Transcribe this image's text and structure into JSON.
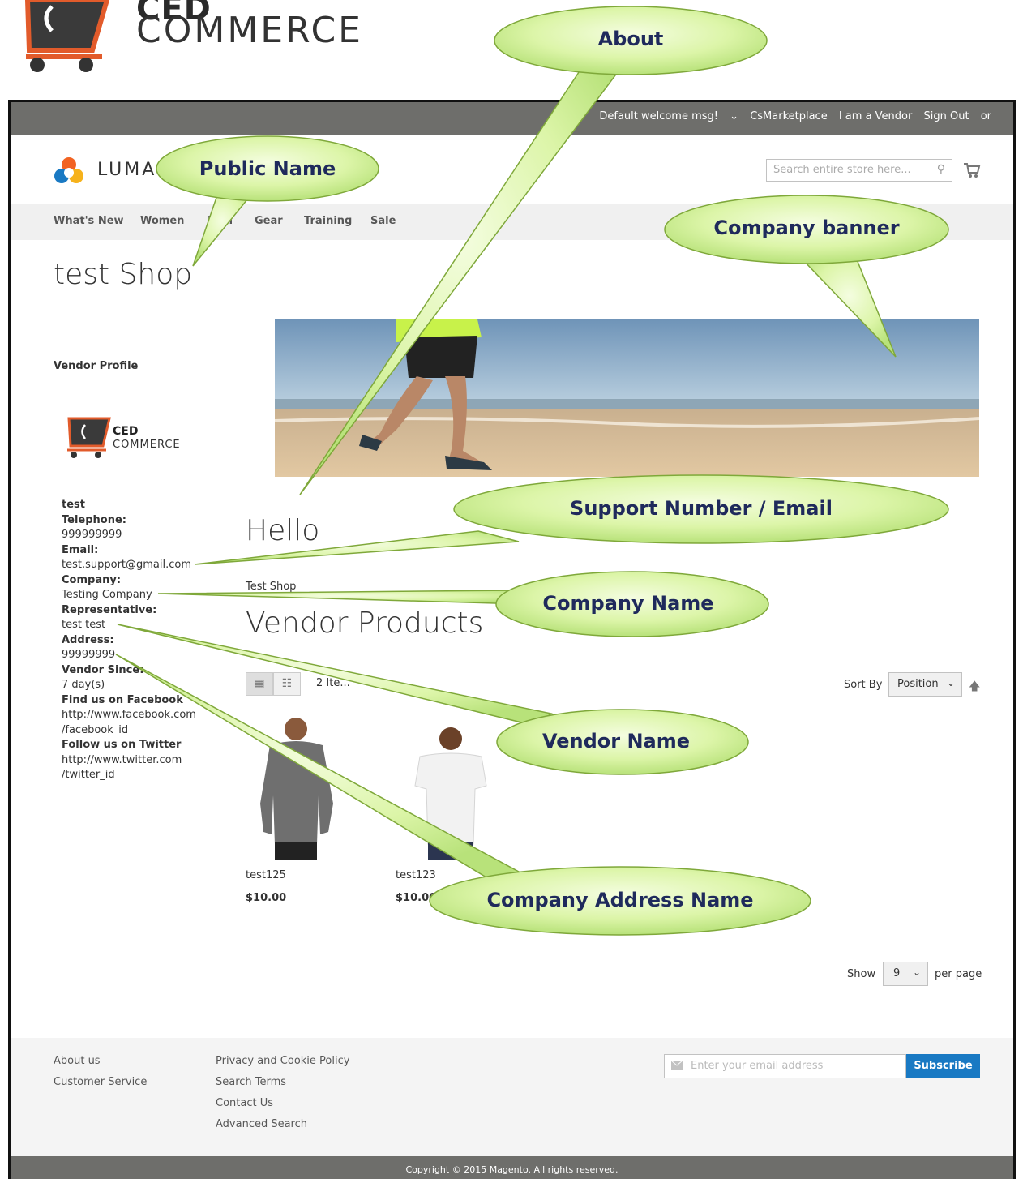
{
  "brand": {
    "ced": "CED",
    "commerce": "COMMERCE"
  },
  "panel": {
    "welcome": "Default welcome msg!",
    "chevron": "⌄",
    "marketplace": "CsMarketplace",
    "vendor": "I am a Vendor",
    "signout": "Sign Out",
    "or": "or"
  },
  "header": {
    "logo_text": "LUMA",
    "search_placeholder": "Search entire store here..."
  },
  "nav": {
    "items": [
      "What's New",
      "Women",
      "Men",
      "Gear",
      "Training",
      "Sale"
    ]
  },
  "page": {
    "title": "test Shop"
  },
  "sidebar": {
    "title": "Vendor Profile",
    "logo_ced": "CED",
    "logo_commerce": "COMMERCE",
    "name": "test",
    "telephone_label": "Telephone:",
    "telephone": "999999999",
    "email_label": "Email:",
    "email": "test.support@gmail.com",
    "company_label": "Company:",
    "company": "Testing Company",
    "representative_label": "Representative:",
    "representative": "test test",
    "address_label": "Address:",
    "address": "99999999",
    "since_label": "Vendor Since:",
    "since": "7 day(s)",
    "facebook_label": "Find us on Facebook",
    "facebook_1": "http://www.facebook.com",
    "facebook_2": "/facebook_id",
    "twitter_label": "Follow us on Twitter",
    "twitter_1": "http://www.twitter.com",
    "twitter_2": "/twitter_id"
  },
  "main": {
    "about": "Hello",
    "shop_name": "Test Shop",
    "products_title": "Vendor Products",
    "count": "2 Ite...",
    "sort_label": "Sort By",
    "sort_value": "Position",
    "products": [
      {
        "name": "test125",
        "price": "$10.00",
        "shirt_color": "#6f6f6f"
      },
      {
        "name": "test123",
        "price": "$10.00",
        "shirt_color": "#f2f2f2"
      }
    ],
    "show_label": "Show",
    "limit": "9",
    "per_page": "per page"
  },
  "footer": {
    "col1": [
      "About us",
      "Customer Service"
    ],
    "col2": [
      "Privacy and Cookie Policy",
      "Search Terms",
      "Contact Us",
      "Advanced Search"
    ],
    "news_placeholder": "Enter your email address",
    "subscribe": "Subscribe",
    "copyright": "Copyright © 2015 Magento. All rights reserved."
  },
  "callouts": {
    "about": "About",
    "public_name": "Public Name",
    "company_banner": "Company banner",
    "support": "Support Number / Email",
    "company_name": "Company Name",
    "vendor_name": "Vendor Name",
    "company_address": "Company Address Name"
  },
  "colors": {
    "callout_fill": "#d6f2a0",
    "callout_stroke": "#7fa83a",
    "accent": "#1979c3",
    "panel": "#6e6e6b"
  }
}
